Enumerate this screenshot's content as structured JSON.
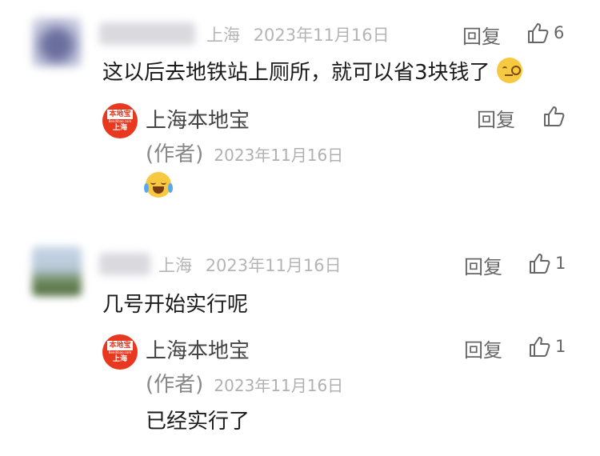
{
  "comments": [
    {
      "location": "上海",
      "date": "2023年11月16日",
      "reply_label": "回复",
      "like_count": "6",
      "text": "这以后去地铁站上厕所，就可以省3块钱了",
      "emoji": "thinking-face-icon",
      "reply": {
        "author": "上海本地宝",
        "logo_top": "本地宝",
        "logo_mid": "Bendibao.com",
        "logo_bot": "上海",
        "tag": "(作者)",
        "date": "2023年11月16日",
        "reply_label": "回复",
        "like_count": "",
        "text": "",
        "emoji": "crying-face-icon"
      }
    },
    {
      "location": "上海",
      "date": "2023年11月16日",
      "reply_label": "回复",
      "like_count": "1",
      "text": "几号开始实行呢",
      "reply": {
        "author": "上海本地宝",
        "logo_top": "本地宝",
        "logo_mid": "Bendibao.com",
        "logo_bot": "上海",
        "tag": "(作者)",
        "date": "2023年11月16日",
        "reply_label": "回复",
        "like_count": "1",
        "text": "已经实行了"
      }
    }
  ],
  "colors": {
    "accent": "#e8381f",
    "meta": "#b5b5b5"
  }
}
